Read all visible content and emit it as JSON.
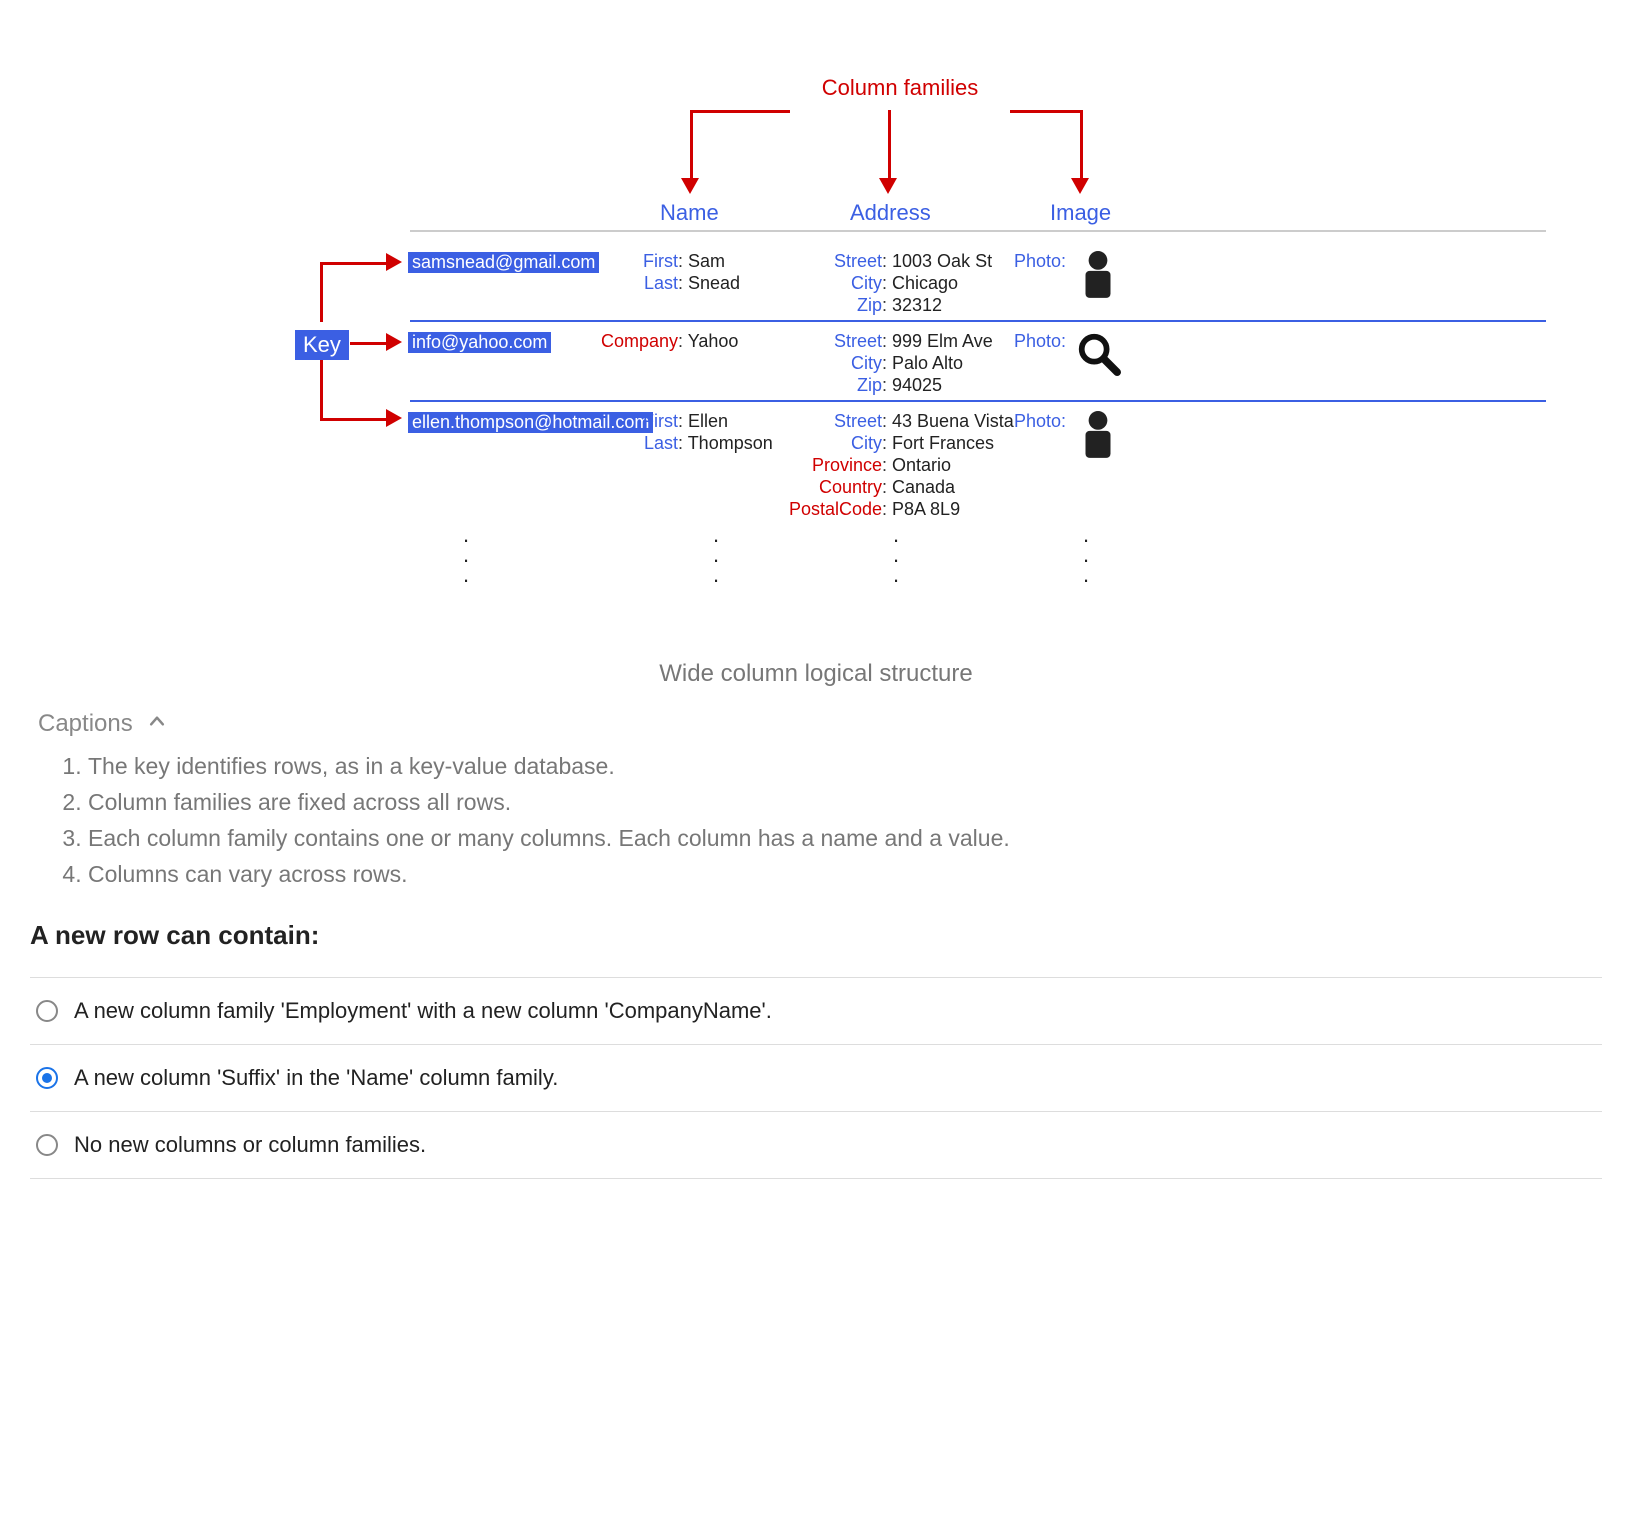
{
  "diagram": {
    "cf_header": "Column families",
    "families": [
      "Name",
      "Address",
      "Image"
    ],
    "key_label": "Key",
    "rows": [
      {
        "key": "samsnead@gmail.com",
        "name": [
          [
            "First",
            "Sam"
          ],
          [
            "Last",
            "Snead"
          ]
        ],
        "address": [
          [
            "Street",
            "1003 Oak St"
          ],
          [
            "City",
            "Chicago"
          ],
          [
            "Zip",
            "32312"
          ]
        ],
        "image_icon": "person"
      },
      {
        "key": "info@yahoo.com",
        "company": [
          [
            "Company",
            "Yahoo"
          ]
        ],
        "address": [
          [
            "Street",
            "999 Elm Ave"
          ],
          [
            "City",
            "Palo Alto"
          ],
          [
            "Zip",
            "94025"
          ]
        ],
        "image_icon": "magnifier"
      },
      {
        "key": "ellen.thompson@hotmail.com",
        "name": [
          [
            "First",
            "Ellen"
          ],
          [
            "Last",
            "Thompson"
          ]
        ],
        "address_full": [
          [
            "Street",
            "43 Buena Vista"
          ],
          [
            "City",
            "Fort Frances"
          ],
          [
            "Province",
            "Ontario"
          ],
          [
            "Country",
            "Canada"
          ],
          [
            "PostalCode",
            "P8A 8L9"
          ]
        ],
        "image_icon": "person"
      }
    ],
    "photo_label": "Photo:",
    "figure_caption": "Wide column logical structure"
  },
  "captions_header": "Captions",
  "captions": [
    "The key identifies rows, as in a key-value database.",
    "Column families are fixed across all rows.",
    "Each column family contains one or many columns. Each column has a name and a value.",
    "Columns can vary across rows."
  ],
  "question": "A new row can contain:",
  "answers": [
    "A new column family 'Employment' with a new column 'CompanyName'.",
    "A new column 'Suffix' in the 'Name' column family.",
    "No new columns or column families."
  ],
  "selected_answer_index": 1
}
